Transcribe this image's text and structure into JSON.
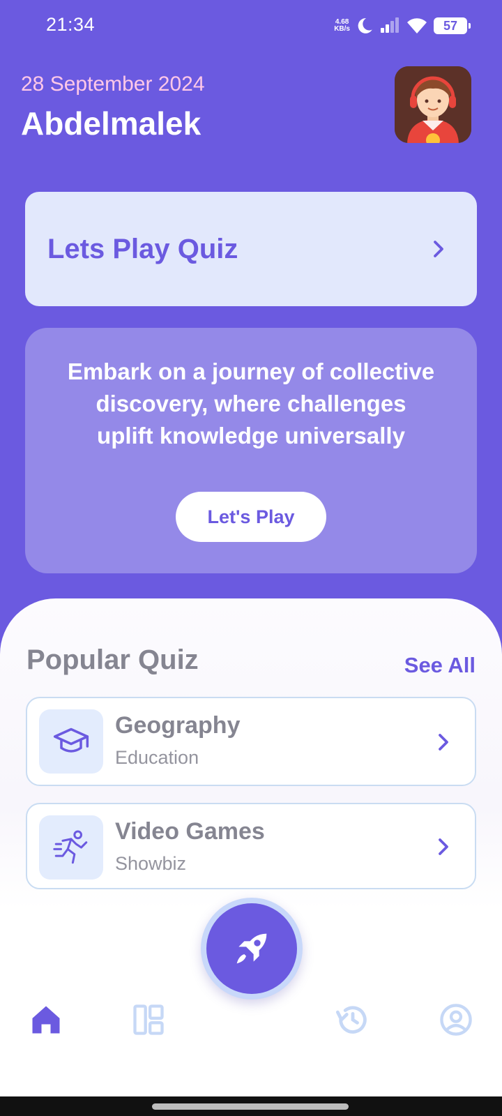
{
  "status": {
    "time": "21:34",
    "net_speed_value": "4.68",
    "net_speed_unit": "KB/s",
    "battery": "57"
  },
  "header": {
    "date": "28 September 2024",
    "name": "Abdelmalek"
  },
  "play_card": {
    "title": "Lets Play Quiz"
  },
  "promo": {
    "text": "Embark on a journey of collective discovery, where challenges uplift knowledge universally",
    "button_label": "Let's Play"
  },
  "popular": {
    "title": "Popular Quiz",
    "see_all": "See All",
    "items": [
      {
        "title": "Geography",
        "category": "Education",
        "icon": "graduation-cap-icon"
      },
      {
        "title": "Video Games",
        "category": "Showbiz",
        "icon": "running-person-icon"
      }
    ]
  },
  "nav": {
    "items": [
      "home-icon",
      "dashboard-icon",
      "rocket-icon",
      "history-icon",
      "profile-icon"
    ],
    "active": "home-icon"
  },
  "colors": {
    "primary": "#6b5ae0",
    "light_card": "#e2e8fc",
    "promo_card": "#9489e8",
    "date_pink": "#ffc8e8"
  }
}
